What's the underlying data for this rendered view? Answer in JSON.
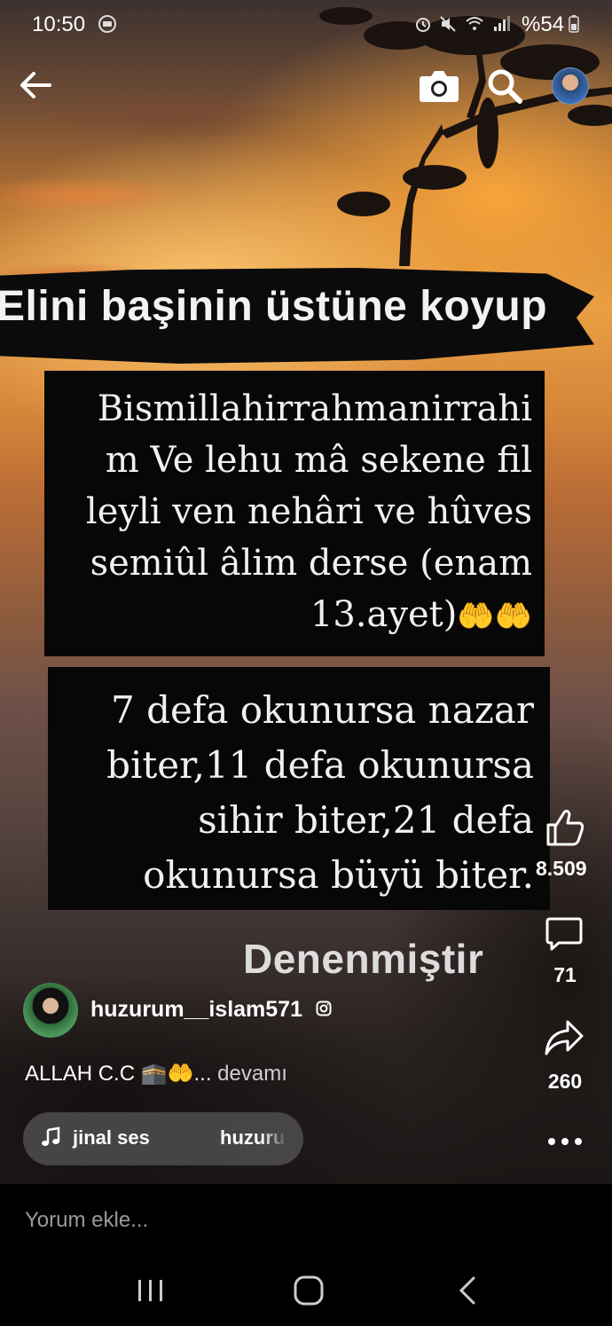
{
  "status_bar": {
    "time": "10:50",
    "battery": "%54",
    "icons": [
      "messages-icon",
      "alarm-icon",
      "mute-icon",
      "wifi-icon",
      "signal-icon",
      "battery-icon"
    ]
  },
  "top_bar": {
    "icons": [
      "back-arrow-icon",
      "camera-icon",
      "search-icon",
      "profile-avatar"
    ]
  },
  "video_overlay": {
    "title": "Elini başinin üstüne koyup",
    "box1_lines": [
      "Bismillahirrahmanirrahi",
      "m Ve lehu mâ sekene fil",
      "leyli ven nehâri ve hûves",
      "semiûl âlim derse (enam"
    ],
    "box1_last": "13.ayet)",
    "hands_emoji": "🤲🤲",
    "box2_lines": [
      "7 defa okunursa nazar",
      "biter,11 defa okunursa",
      "sihir biter,21 defa",
      "okunursa büyü biter."
    ],
    "subtitle": "Denenmiştir"
  },
  "actions": {
    "likes": "8.509",
    "comments": "71",
    "shares": "260"
  },
  "author": {
    "name": "huzurum__islam571"
  },
  "caption": {
    "text": "ALLAH C.C 🕋🤲...",
    "more_label": "devamı"
  },
  "audio": {
    "title": "jinal ses",
    "author": "huzurum"
  },
  "comment_bar": {
    "placeholder": "Yorum ekle..."
  },
  "colors": {
    "box_bg": "#070707",
    "sky_orange": "#e19a45",
    "pill_bg": "#5a5a5a"
  }
}
